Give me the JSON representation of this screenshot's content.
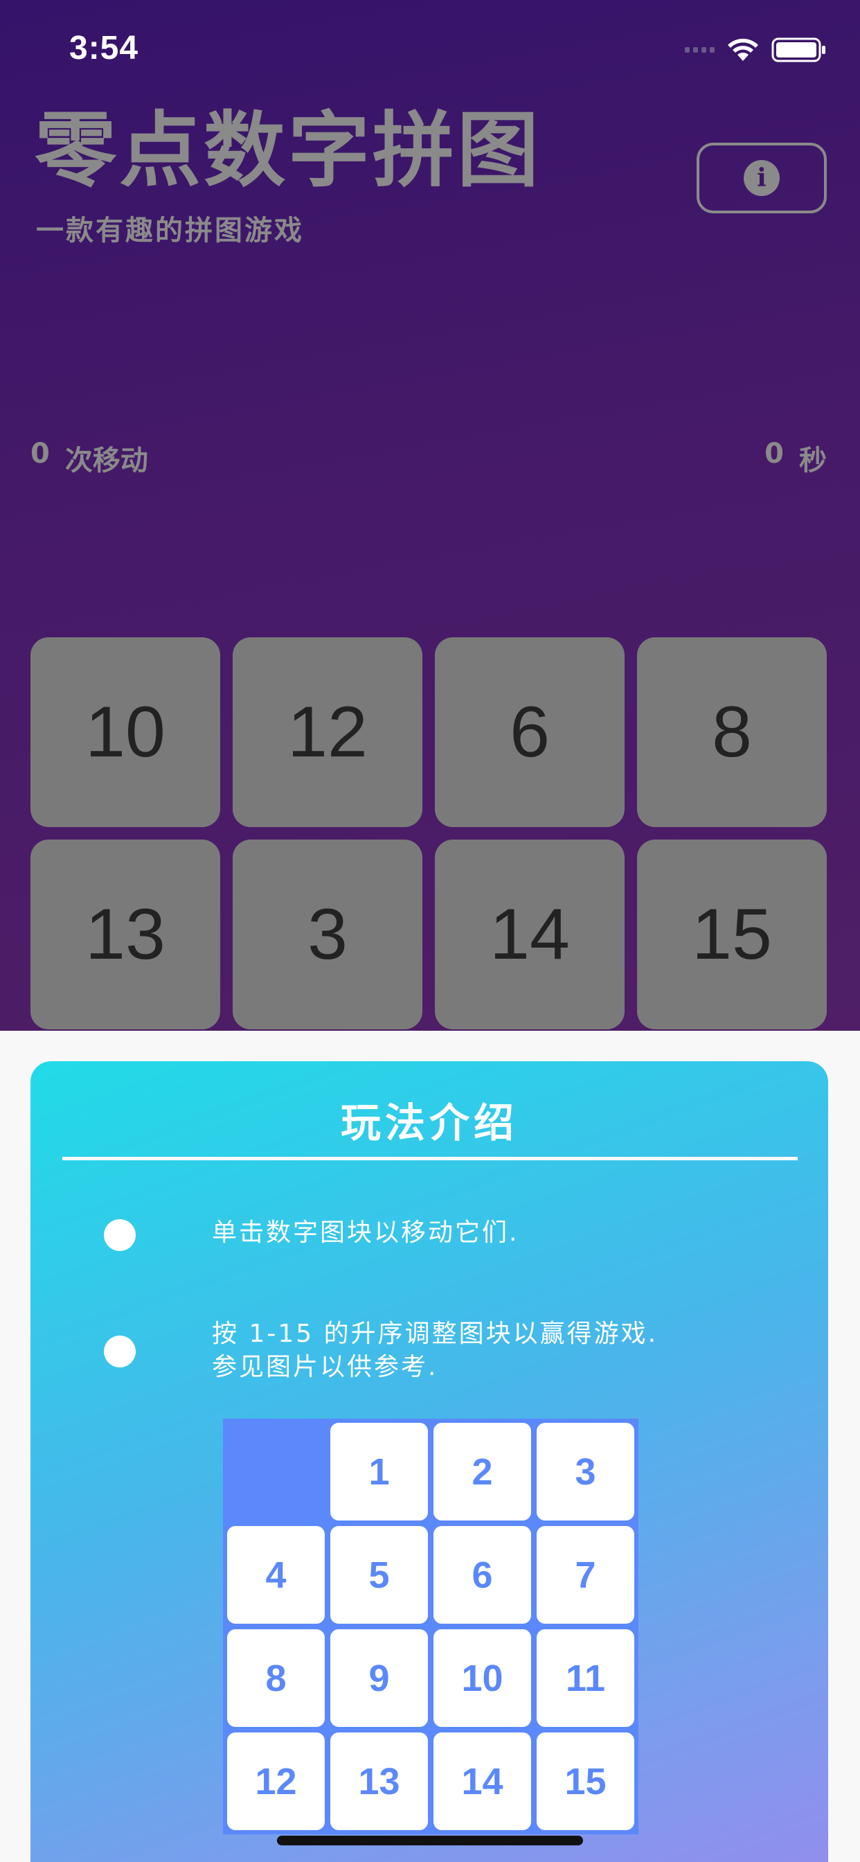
{
  "status_bar": {
    "time": "3:54",
    "icons": [
      "signal-icon",
      "wifi-icon",
      "battery-icon"
    ]
  },
  "header": {
    "title": "零点数字拼图",
    "subtitle": "一款有趣的拼图游戏",
    "info_icon": "info-icon",
    "info_glyph": "i"
  },
  "stats": {
    "moves_value": "0",
    "moves_label": "次移动",
    "time_value": "0",
    "time_label": "秒"
  },
  "board": {
    "tiles": [
      "10",
      "12",
      "6",
      "8",
      "13",
      "3",
      "14",
      "15"
    ]
  },
  "instructions": {
    "title": "玩法介绍",
    "rules": [
      "单击数字图块以移动它们.",
      "按 1-15 的升序调整图块以赢得游戏.",
      "参见图片以供参考."
    ],
    "reference_grid": [
      "",
      "1",
      "2",
      "3",
      "4",
      "5",
      "6",
      "7",
      "8",
      "9",
      "10",
      "11",
      "12",
      "13",
      "14",
      "15"
    ]
  },
  "colors": {
    "background_top": "#35136a",
    "tile": "#7a7a7a",
    "card_start": "#21dbe8",
    "card_end": "#948cee",
    "reference_blue": "#5b88fa"
  }
}
